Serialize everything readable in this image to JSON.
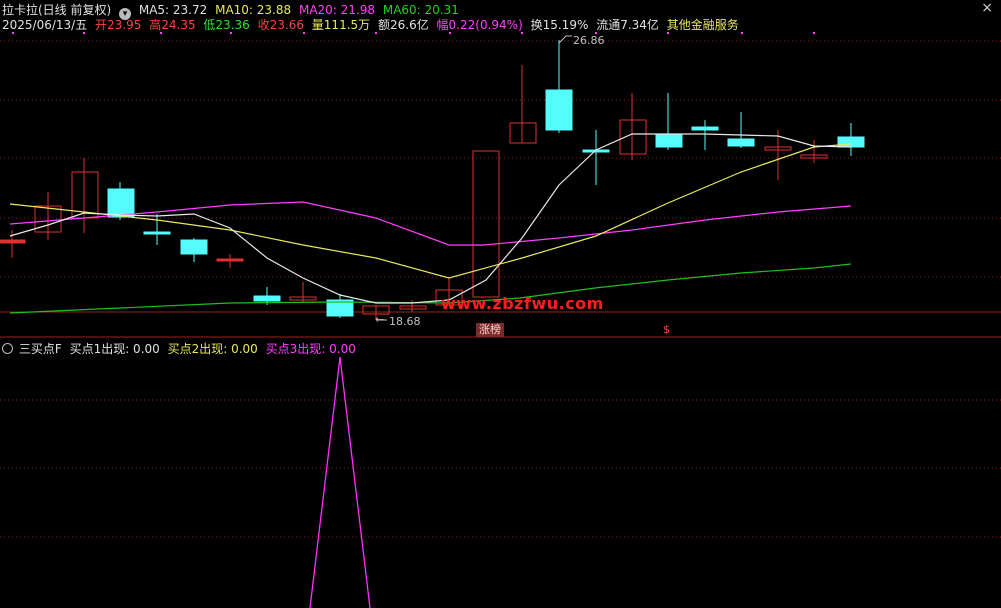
{
  "header": {
    "stock_name": "拉卡拉(日线 前复权)",
    "ma5": "MA5: 23.72",
    "ma10": "MA10: 23.88",
    "ma20": "MA20: 21.98",
    "ma60": "MA60: 20.31",
    "close_glyph": "×"
  },
  "quote": {
    "date": "2025/06/13/五",
    "open": "开23.95",
    "high": "高24.35",
    "low": "低23.36",
    "close": "收23.66",
    "volume": "量111.5万",
    "amount": "额26.6亿",
    "change": "幅0.22(0.94%)",
    "turnover": "换15.19%",
    "float": "流通7.34亿",
    "sector": "其他金融服务"
  },
  "annotations": {
    "max_price": "26.86",
    "min_price": "18.68",
    "watermark": "www.zbzfwu.com",
    "badge_label": "涨榜",
    "badge_symbol": "$"
  },
  "indicator": {
    "name": "三买点F",
    "buy1": "买点1出现: 0.00",
    "buy2": "买点2出现: 0.00",
    "buy3": "买点3出现: 0.00"
  },
  "colors": {
    "up": "#e03030",
    "down": "#54fcfc",
    "ma5": "#ffffff",
    "ma10": "#e8e85c",
    "ma20": "#ff40ff",
    "ma60": "#20c020",
    "indicator_line": "#ff30ff"
  }
}
